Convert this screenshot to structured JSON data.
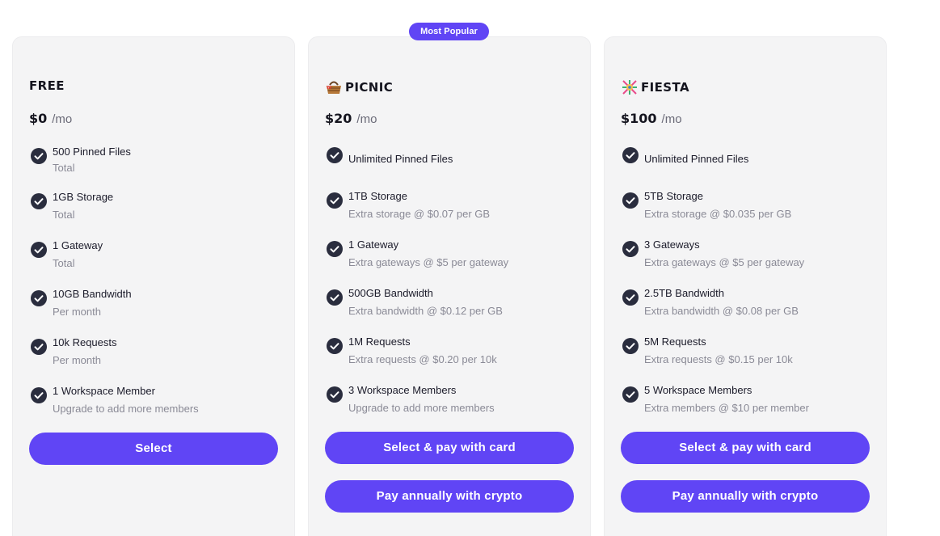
{
  "badge": "Most Popular",
  "plans": [
    {
      "name": "FREE",
      "icon": "none",
      "price": "$0",
      "period": "/mo",
      "features": [
        {
          "title": "500 Pinned Files",
          "sub": "Total"
        },
        {
          "title": "1GB Storage",
          "sub": "Total"
        },
        {
          "title": "1 Gateway",
          "sub": "Total"
        },
        {
          "title": "10GB Bandwidth",
          "sub": "Per month"
        },
        {
          "title": "10k Requests",
          "sub": "Per month"
        },
        {
          "title": "1 Workspace Member",
          "sub": "Upgrade to add more members"
        }
      ],
      "buttons": [
        "Select"
      ]
    },
    {
      "name": "PICNIC",
      "icon": "picnic-basket-icon",
      "price": "$20",
      "period": "/mo",
      "features": [
        {
          "title": "Unlimited Pinned Files",
          "sub": ""
        },
        {
          "title": "1TB Storage",
          "sub": "Extra storage @ $0.07 per GB"
        },
        {
          "title": "1 Gateway",
          "sub": "Extra gateways @ $5 per gateway"
        },
        {
          "title": "500GB Bandwidth",
          "sub": "Extra bandwidth @ $0.12 per GB"
        },
        {
          "title": "1M Requests",
          "sub": "Extra requests @ $0.20 per 10k"
        },
        {
          "title": "3 Workspace Members",
          "sub": "Upgrade to add more members"
        }
      ],
      "buttons": [
        "Select & pay with card",
        "Pay annually with crypto"
      ]
    },
    {
      "name": "FIESTA",
      "icon": "pinata-icon",
      "price": "$100",
      "period": "/mo",
      "features": [
        {
          "title": "Unlimited Pinned Files",
          "sub": ""
        },
        {
          "title": "5TB Storage",
          "sub": "Extra storage @ $0.035 per GB"
        },
        {
          "title": "3 Gateways",
          "sub": "Extra gateways @ $5 per gateway"
        },
        {
          "title": "2.5TB Bandwidth",
          "sub": "Extra bandwidth @ $0.08 per GB"
        },
        {
          "title": "5M Requests",
          "sub": "Extra requests @ $0.15 per 10k"
        },
        {
          "title": "5 Workspace Members",
          "sub": "Extra members @ $10 per member"
        }
      ],
      "buttons": [
        "Select & pay with card",
        "Pay annually with crypto"
      ]
    }
  ],
  "colors": {
    "accent": "#6045f5",
    "card_bg": "#f4f4f5",
    "check": "#2a2d3e",
    "muted_text": "#8a8a96"
  }
}
